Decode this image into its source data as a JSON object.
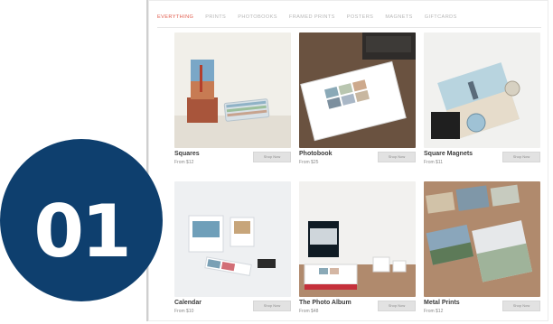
{
  "nav": {
    "items": [
      "EVERYTHING",
      "PRINTS",
      "PHOTOBOOKS",
      "FRAMED PRINTS",
      "POSTERS",
      "MAGNETS",
      "GIFTCARDS"
    ],
    "active": "EVERYTHING",
    "active_color": "#e05b4b"
  },
  "products": [
    {
      "title": "Squares",
      "price": "From $12",
      "button": "Shop Now"
    },
    {
      "title": "Photobook",
      "price": "From $25",
      "button": "Shop Now"
    },
    {
      "title": "Square Magnets",
      "price": "From $11",
      "button": "Shop Now"
    },
    {
      "title": "Calendar",
      "price": "From $10",
      "button": "Shop Now"
    },
    {
      "title": "The Photo Album",
      "price": "From $48",
      "button": "Shop Now"
    },
    {
      "title": "Metal Prints",
      "price": "From $12",
      "button": "Shop Now"
    }
  ],
  "badge": {
    "number": "01",
    "color": "#0e3f6e"
  }
}
